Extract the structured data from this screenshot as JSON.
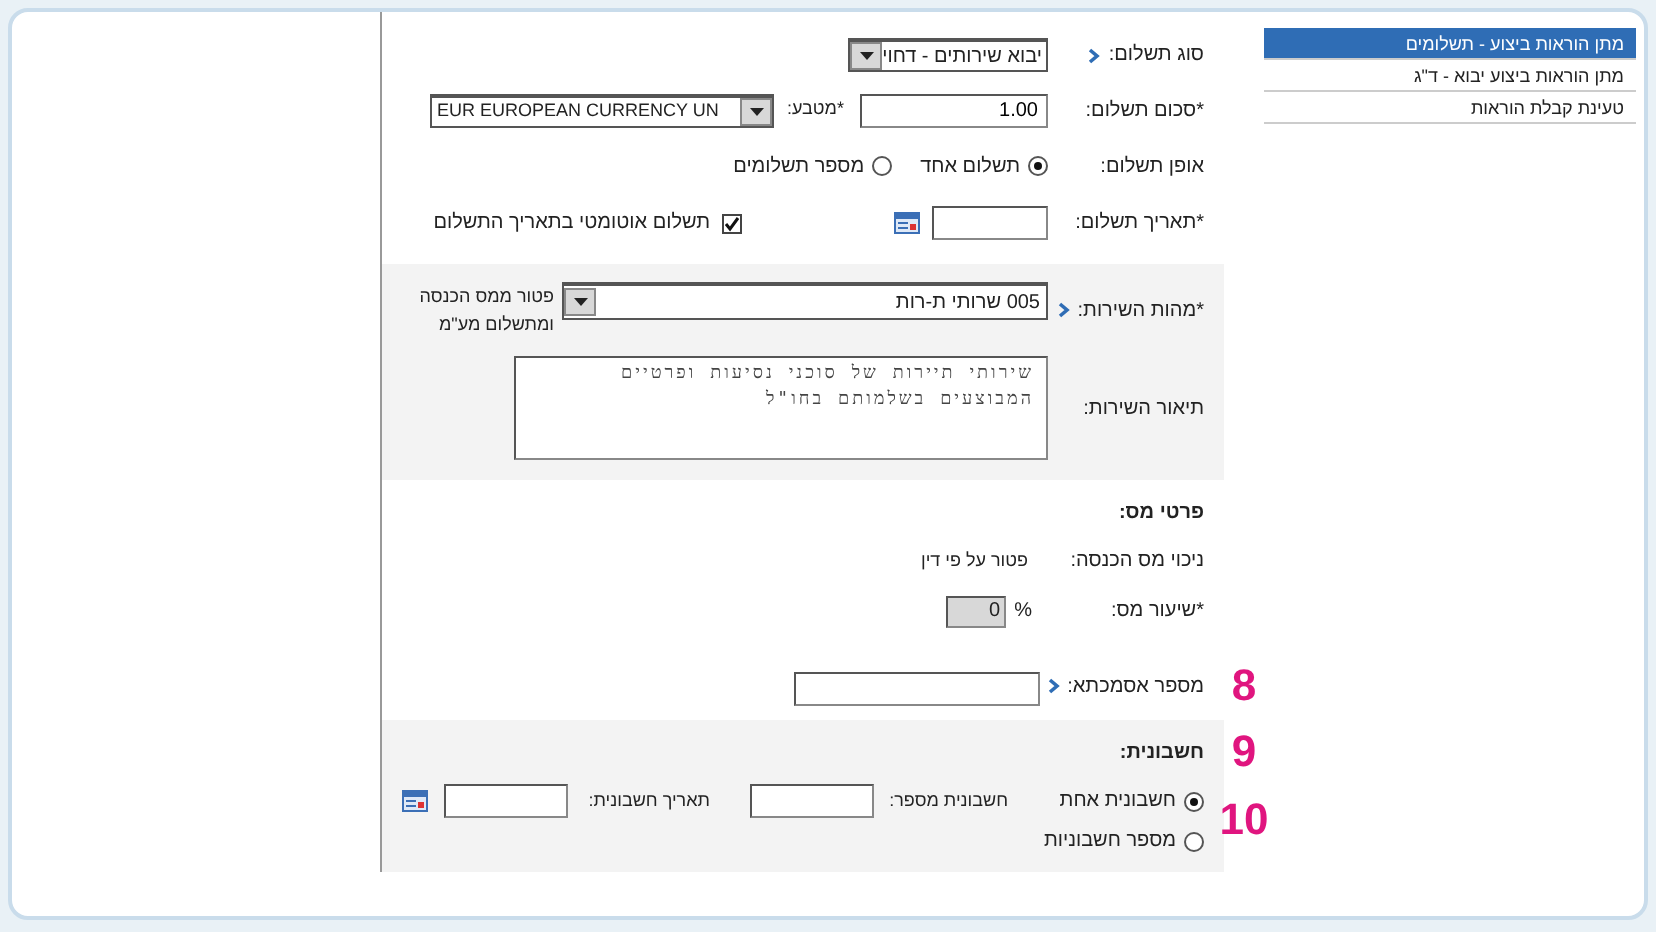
{
  "sidebar": {
    "items": [
      {
        "label": "מתן הוראות ביצוע - תשלומים",
        "selected": true
      },
      {
        "label": "מתן הוראות ביצוע יבוא - ד\"ג",
        "selected": false
      },
      {
        "label": "טעינת קבלת הוראות",
        "selected": false
      }
    ]
  },
  "form": {
    "sections": [
      {
        "shaded": false,
        "rows": [
          {
            "kind": "select",
            "label": "סוג תשלום:",
            "marker": true,
            "value": "יבוא שירותים - דחוי"
          },
          {
            "kind": "amount",
            "label": "*סכום תשלום:",
            "value": "1.00",
            "currency_label": "*מטבע:",
            "currency": "EUR EUROPEAN CURRENCY UN"
          },
          {
            "kind": "radios",
            "label": "אופן תשלום:",
            "options": [
              {
                "label": "תשלום אחד",
                "selected": true
              },
              {
                "label": "מספר תשלומים",
                "selected": false
              }
            ]
          },
          {
            "kind": "date",
            "label": "*תאריך תשלום:",
            "checkbox": {
              "label": "תשלום אוטומטי בתאריך התשלום",
              "checked": true
            }
          }
        ]
      },
      {
        "shaded": true,
        "rows": [
          {
            "kind": "service",
            "label": "*מהות השירות:",
            "marker": true,
            "value": "005 שרותי ת-רות",
            "note": "פטור ממס הכנסה ומתשלום מע\"מ"
          },
          {
            "kind": "textarea",
            "label": "תיאור השירות:",
            "value": "שירותי תיירות של סוכני נסיעות ופרטיים המבוצעים בשלמותם בחו\"ל"
          }
        ]
      },
      {
        "shaded": false,
        "rows": [
          {
            "kind": "heading",
            "label": "פרטי מס:"
          },
          {
            "kind": "text",
            "label": "ניכוי מס הכנסה:",
            "value": "פטור על פי דין"
          },
          {
            "kind": "rate",
            "label": "*שיעור מס:",
            "unit": "%",
            "value": "0"
          }
        ]
      },
      {
        "shaded": false,
        "rows": [
          {
            "kind": "input",
            "label": "מספר אסמכתא:",
            "marker": true,
            "callout": "8"
          }
        ]
      },
      {
        "shaded": true,
        "rows": [
          {
            "kind": "heading",
            "label": "חשבונית:",
            "callout": "9"
          },
          {
            "kind": "invoice",
            "options": [
              {
                "label": "חשבונית אחת",
                "selected": true
              },
              {
                "label": "מספר חשבוניות",
                "selected": false
              }
            ],
            "number_label": "חשבונית מספר:",
            "date_label": "תאריך חשבונית:",
            "callout": "10"
          }
        ]
      }
    ]
  }
}
